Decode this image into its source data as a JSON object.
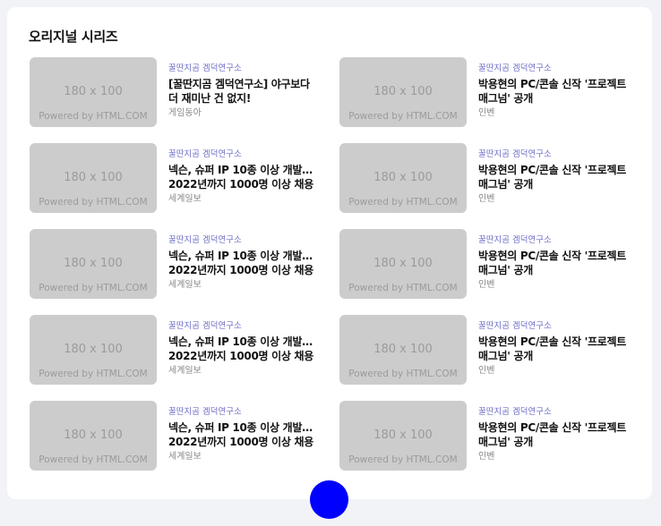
{
  "section": {
    "title": "오리지널 시리즈"
  },
  "thumbnail": {
    "size_text": "180 x 100",
    "credit_text": "Powered by HTML.COM"
  },
  "items": [
    {
      "category": "꿀딴지곰 겜덕연구소",
      "title": "[꿀딴지곰 겜덕연구소] 야구보다 더 재미난 건 없지!",
      "source": "게임동아"
    },
    {
      "category": "꿀딴지곰 겜덕연구소",
      "title": "박용현의 PC/콘솔 신작 '프로젝트 매그넘' 공개",
      "source": "인벤"
    },
    {
      "category": "꿀딴지곰 겜덕연구소",
      "title": "넥슨, 슈퍼 IP 10종 이상 개발… 2022년까지 1000명 이상 채용",
      "source": "세계일보"
    },
    {
      "category": "꿀딴지곰 겜덕연구소",
      "title": "박용현의 PC/콘솔 신작 '프로젝트 매그넘' 공개",
      "source": "인벤"
    },
    {
      "category": "꿀딴지곰 겜덕연구소",
      "title": "넥슨, 슈퍼 IP 10종 이상 개발… 2022년까지 1000명 이상 채용",
      "source": "세계일보"
    },
    {
      "category": "꿀딴지곰 겜덕연구소",
      "title": "박용현의 PC/콘솔 신작 '프로젝트 매그넘' 공개",
      "source": "인벤"
    },
    {
      "category": "꿀딴지곰 겜덕연구소",
      "title": "넥슨, 슈퍼 IP 10종 이상 개발… 2022년까지 1000명 이상 채용",
      "source": "세계일보"
    },
    {
      "category": "꿀딴지곰 겜덕연구소",
      "title": "박용현의 PC/콘솔 신작 '프로젝트 매그넘' 공개",
      "source": "인벤"
    },
    {
      "category": "꿀딴지곰 겜덕연구소",
      "title": "넥슨, 슈퍼 IP 10종 이상 개발… 2022년까지 1000명 이상 채용",
      "source": "세계일보"
    },
    {
      "category": "꿀딴지곰 겜덕연구소",
      "title": "박용현의 PC/콘솔 신작 '프로젝트 매그넘' 공개",
      "source": "인벤"
    }
  ],
  "colors": {
    "accent_button": "#0000ff",
    "category_text": "#6f6fc8",
    "thumbnail_placeholder": "#cccccc"
  }
}
